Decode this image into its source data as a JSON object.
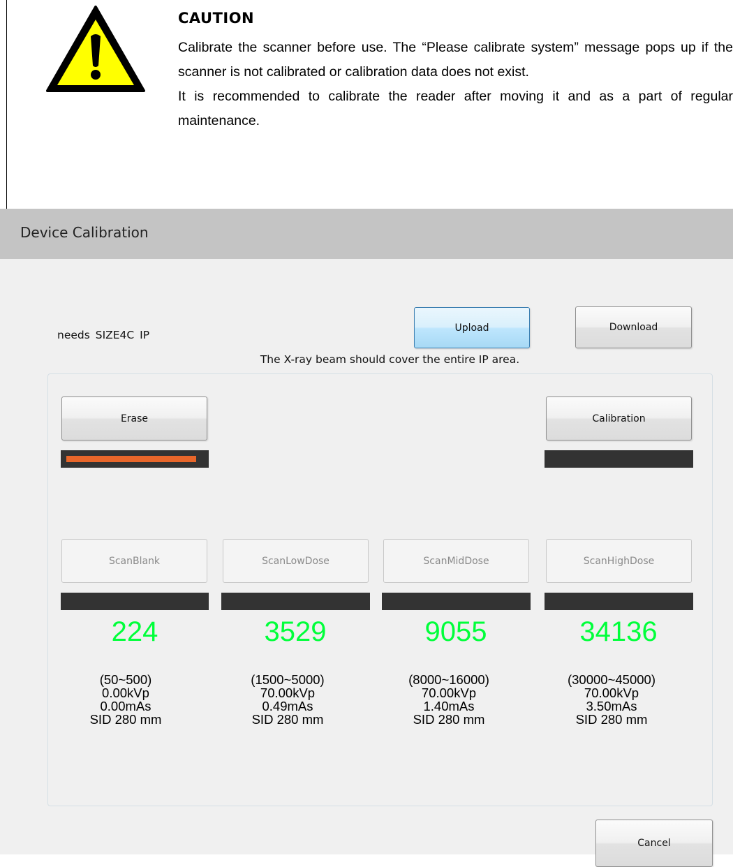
{
  "caution": {
    "icon": "warning-triangle-icon",
    "title": "CAUTION",
    "paragraph1": "Calibrate the scanner before use. The “Please calibrate system” message pops up if the scanner is not calibrated or calibration data does not exist.",
    "paragraph2": "It is recommended to calibrate the reader after moving it and as a part of regular maintenance."
  },
  "dialog": {
    "title": "Device Calibration",
    "instruction": "The X-ray beam should cover the entire IP area.",
    "needs": "needs  SIZE4C IP",
    "upload_label": "Upload",
    "download_label": "Download",
    "cancel_label": "Cancel",
    "erase": {
      "label": "Erase",
      "progress": 0.95,
      "progress_color": "#e8662a"
    },
    "calibration": {
      "label": "Calibration",
      "progress": 0
    },
    "scans": [
      {
        "label": "ScanBlank",
        "value": "224",
        "range": "(50~500)",
        "kvp": "0.00kVp",
        "mas": "0.00mAs",
        "sid": "SID 280 mm",
        "progress": 0
      },
      {
        "label": "ScanLowDose",
        "value": "3529",
        "range": "(1500~5000)",
        "kvp": "70.00kVp",
        "mas": "0.49mAs",
        "sid": "SID 280 mm",
        "progress": 0
      },
      {
        "label": "ScanMidDose",
        "value": "9055",
        "range": "(8000~16000)",
        "kvp": "70.00kVp",
        "mas": "1.40mAs",
        "sid": "SID 280 mm",
        "progress": 0
      },
      {
        "label": "ScanHighDose",
        "value": "34136",
        "range": "(30000~45000)",
        "kvp": "70.00kVp",
        "mas": "3.50mAs",
        "sid": "SID 280 mm",
        "progress": 0
      }
    ],
    "colors": {
      "reading": "#00ff3a",
      "progress_track": "#333333",
      "titlebar": "#c4c4c4"
    }
  }
}
